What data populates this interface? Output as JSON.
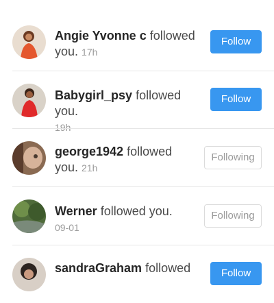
{
  "notifications": [
    {
      "username": "Angie Yvonne c",
      "action": "followed",
      "suffix": "you.",
      "time": "17h",
      "button": "Follow",
      "button_state": "follow"
    },
    {
      "username": "Babygirl_psy",
      "action": "followed you.",
      "suffix": "",
      "time": "19h",
      "button": "Follow",
      "button_state": "follow"
    },
    {
      "username": "george1942",
      "action": "followed",
      "suffix": "you.",
      "time": "21h",
      "button": "Following",
      "button_state": "following"
    },
    {
      "username": "Werner",
      "action": "followed you.",
      "suffix": "",
      "time": "09-01",
      "button": "Following",
      "button_state": "following"
    },
    {
      "username": "sandraGraham",
      "action": "followed",
      "suffix": "",
      "time": "",
      "button": "Follow",
      "button_state": "follow"
    }
  ],
  "colors": {
    "follow_button": "#3897f0",
    "following_border": "#dbdbdb",
    "username_text": "#262626",
    "timestamp": "#9a9a9a"
  }
}
